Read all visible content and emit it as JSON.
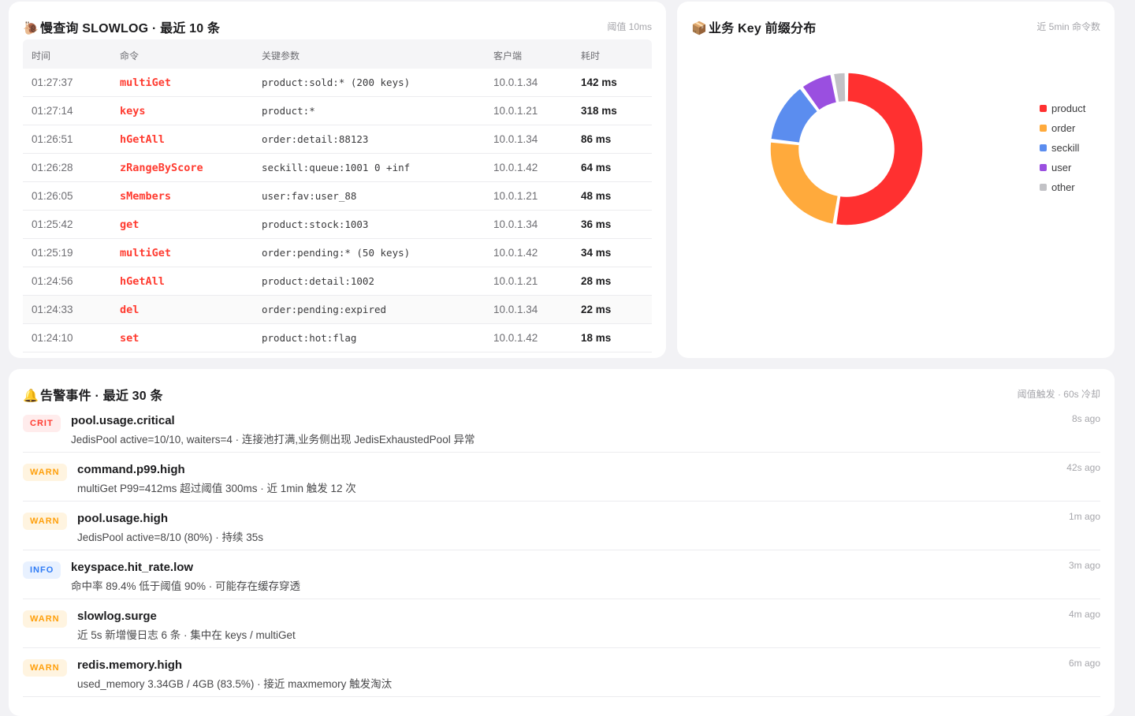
{
  "slowlog": {
    "icon": "🐌",
    "title": "慢查询 SLOWLOG · 最近 10 条",
    "meta": "阈值 10ms",
    "columns": [
      "时间",
      "命令",
      "关键参数",
      "客户端",
      "耗时"
    ],
    "rows": [
      {
        "time": "01:27:37",
        "cmd": "multiGet",
        "key": "product:sold:* (200 keys)",
        "client": "10.0.1.34",
        "dur": "142 ms"
      },
      {
        "time": "01:27:14",
        "cmd": "keys",
        "key": "product:*",
        "client": "10.0.1.21",
        "dur": "318 ms"
      },
      {
        "time": "01:26:51",
        "cmd": "hGetAll",
        "key": "order:detail:88123",
        "client": "10.0.1.34",
        "dur": "86 ms"
      },
      {
        "time": "01:26:28",
        "cmd": "zRangeByScore",
        "key": "seckill:queue:1001 0 +inf",
        "client": "10.0.1.42",
        "dur": "64 ms"
      },
      {
        "time": "01:26:05",
        "cmd": "sMembers",
        "key": "user:fav:user_88",
        "client": "10.0.1.21",
        "dur": "48 ms"
      },
      {
        "time": "01:25:42",
        "cmd": "get",
        "key": "product:stock:1003",
        "client": "10.0.1.34",
        "dur": "36 ms"
      },
      {
        "time": "01:25:19",
        "cmd": "multiGet",
        "key": "order:pending:* (50 keys)",
        "client": "10.0.1.42",
        "dur": "34 ms"
      },
      {
        "time": "01:24:56",
        "cmd": "hGetAll",
        "key": "product:detail:1002",
        "client": "10.0.1.21",
        "dur": "28 ms"
      },
      {
        "time": "01:24:33",
        "cmd": "del",
        "key": "order:pending:expired",
        "client": "10.0.1.34",
        "dur": "22 ms"
      },
      {
        "time": "01:24:10",
        "cmd": "set",
        "key": "product:hot:flag",
        "client": "10.0.1.42",
        "dur": "18 ms"
      }
    ]
  },
  "keydist": {
    "icon": "📦",
    "title": "业务 Key 前缀分布",
    "meta": "近 5min 命令数"
  },
  "chart_data": {
    "type": "pie",
    "donut": true,
    "categories": [
      "product",
      "order",
      "seckill",
      "user",
      "other"
    ],
    "values": [
      52,
      24,
      13,
      7,
      3
    ],
    "colors": [
      "#ff3030",
      "#ffaa3c",
      "#5b8def",
      "#9a4fe0",
      "#c2c2c6"
    ],
    "legend_position": "right"
  },
  "alerts": {
    "icon": "🔔",
    "title": "告警事件 · 最近 30 条",
    "meta": "阈值触发 · 60s 冷却",
    "items": [
      {
        "level": "CRIT",
        "kind": "crit",
        "title": "pool.usage.critical",
        "desc": "JedisPool active=10/10, waiters=4 · 连接池打满,业务侧出现 JedisExhaustedPool 异常",
        "time": "8s ago"
      },
      {
        "level": "WARN",
        "kind": "warn",
        "title": "command.p99.high",
        "desc": "multiGet P99=412ms 超过阈值 300ms · 近 1min 触发 12 次",
        "time": "42s ago"
      },
      {
        "level": "WARN",
        "kind": "warn",
        "title": "pool.usage.high",
        "desc": "JedisPool active=8/10 (80%) · 持续 35s",
        "time": "1m ago"
      },
      {
        "level": "INFO",
        "kind": "info",
        "title": "keyspace.hit_rate.low",
        "desc": "命中率 89.4% 低于阈值 90% · 可能存在缓存穿透",
        "time": "3m ago"
      },
      {
        "level": "WARN",
        "kind": "warn",
        "title": "slowlog.surge",
        "desc": "近 5s 新增慢日志 6 条 · 集中在 keys / multiGet",
        "time": "4m ago"
      },
      {
        "level": "WARN",
        "kind": "warn",
        "title": "redis.memory.high",
        "desc": "used_memory 3.34GB / 4GB (83.5%) · 接近 maxmemory 触发淘汰",
        "time": "6m ago"
      }
    ]
  }
}
